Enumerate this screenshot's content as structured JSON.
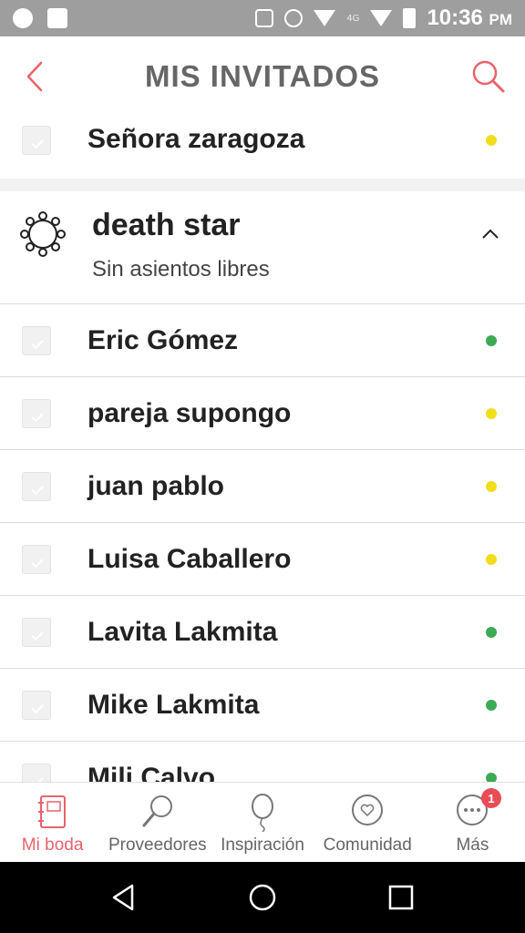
{
  "status_bar": {
    "time": "10:36",
    "ampm": "PM",
    "network": "4G"
  },
  "header": {
    "title": "MIS INVITADOS"
  },
  "first_guest": {
    "name": "Señora zaragoza",
    "status_color": "#f2dd1c"
  },
  "table": {
    "title": "death star",
    "subtitle": "Sin asientos libres"
  },
  "guests": [
    {
      "name": "Eric Gómez",
      "status_color": "#3daa55"
    },
    {
      "name": "pareja supongo",
      "status_color": "#f2dd1c"
    },
    {
      "name": "juan pablo",
      "status_color": "#f2dd1c"
    },
    {
      "name": "Luisa Caballero",
      "status_color": "#f2dd1c"
    },
    {
      "name": "Lavita Lakmita",
      "status_color": "#3daa55"
    },
    {
      "name": "Mike Lakmita",
      "status_color": "#3daa55"
    },
    {
      "name": "Mili Calvo",
      "status_color": "#3daa55"
    }
  ],
  "bottom_nav": [
    {
      "label": "Mi boda",
      "icon": "notebook-icon",
      "active": true
    },
    {
      "label": "Proveedores",
      "icon": "search-icon"
    },
    {
      "label": "Inspiración",
      "icon": "balloon-icon"
    },
    {
      "label": "Comunidad",
      "icon": "chat-heart-icon"
    },
    {
      "label": "Más",
      "icon": "more-icon",
      "badge": "1"
    }
  ],
  "colors": {
    "accent": "#e8636b",
    "status_yellow": "#f2dd1c",
    "status_green": "#3daa55"
  }
}
